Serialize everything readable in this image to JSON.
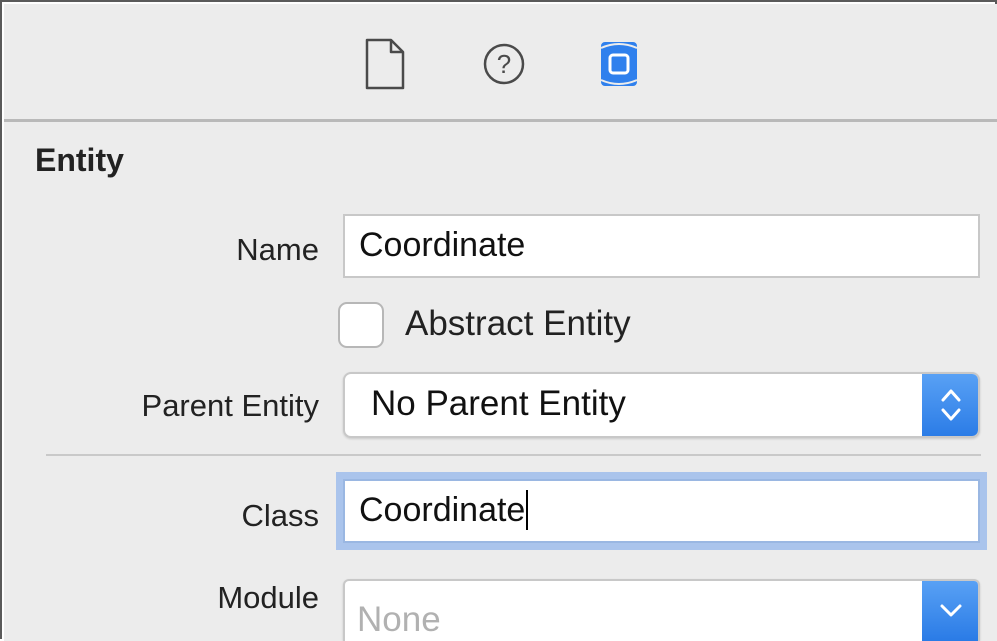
{
  "toolbar": {
    "icons": [
      "file-inspector-icon",
      "quick-help-icon",
      "data-model-inspector-icon"
    ]
  },
  "entity": {
    "section_title": "Entity",
    "name_label": "Name",
    "name_value": "Coordinate",
    "abstract_label": "Abstract Entity",
    "abstract_checked": false,
    "parent_label": "Parent Entity",
    "parent_value": "No Parent Entity",
    "class_label": "Class",
    "class_value": "Coordinate",
    "module_label": "Module",
    "module_placeholder": "None"
  },
  "colors": {
    "accent": "#2f80ed",
    "focus_ring": "#aac4ec",
    "panel_bg": "#ececec"
  }
}
